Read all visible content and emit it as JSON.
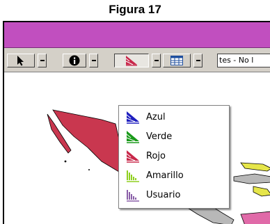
{
  "figure": {
    "caption": "Figura 17"
  },
  "toolbar": {
    "field_text": "tes - No l"
  },
  "menu": {
    "items": [
      {
        "label": "Azul",
        "icon": "blue-ramp-icon",
        "color": "#1f1fbf"
      },
      {
        "label": "Verde",
        "icon": "green-ramp-icon",
        "color": "#1a9a1a"
      },
      {
        "label": "Rojo",
        "icon": "red-ramp-icon",
        "color": "#c8284a"
      },
      {
        "label": "Amarillo",
        "icon": "yellow-ramp-icon",
        "color": "#8fcf1f"
      },
      {
        "label": "Usuario",
        "icon": "user-ramp-icon",
        "color": "#8a5fa8"
      }
    ]
  },
  "colors": {
    "titlebar": "#c14fbf",
    "map_land": "#c9374f",
    "map_gray": "#b8b8b8",
    "map_yellow": "#e6e64a"
  }
}
